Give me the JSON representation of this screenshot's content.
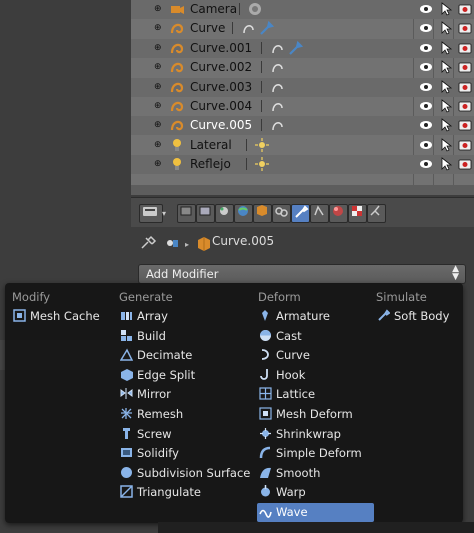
{
  "outliner": {
    "rows": [
      {
        "name": "Camera",
        "kind": "camera",
        "alt": true
      },
      {
        "name": "Curve",
        "kind": "curve",
        "alt": false,
        "wrench": true
      },
      {
        "name": "Curve.001",
        "kind": "curve",
        "alt": true,
        "wrench": true
      },
      {
        "name": "Curve.002",
        "kind": "curve",
        "alt": false
      },
      {
        "name": "Curve.003",
        "kind": "curve",
        "alt": true
      },
      {
        "name": "Curve.004",
        "kind": "curve",
        "alt": false
      },
      {
        "name": "Curve.005",
        "kind": "curve",
        "alt": true,
        "selected": true
      },
      {
        "name": "Lateral",
        "kind": "lamp",
        "alt": false
      },
      {
        "name": "Reflejo",
        "kind": "lamp",
        "alt": true
      }
    ]
  },
  "properties": {
    "active_object": "Curve.005",
    "add_modifier_label": "Add Modifier"
  },
  "menu": {
    "columns": [
      {
        "heading": "Modify",
        "items": [
          {
            "label": "Mesh Cache",
            "icon": "mesh-cache-icon"
          }
        ]
      },
      {
        "heading": "Generate",
        "items": [
          {
            "label": "Array",
            "icon": "array-icon"
          },
          {
            "label": "Build",
            "icon": "build-icon"
          },
          {
            "label": "Decimate",
            "icon": "decimate-icon"
          },
          {
            "label": "Edge Split",
            "icon": "edge-split-icon"
          },
          {
            "label": "Mirror",
            "icon": "mirror-icon"
          },
          {
            "label": "Remesh",
            "icon": "remesh-icon"
          },
          {
            "label": "Screw",
            "icon": "screw-icon"
          },
          {
            "label": "Solidify",
            "icon": "solidify-icon"
          },
          {
            "label": "Subdivision Surface",
            "icon": "subsurf-icon"
          },
          {
            "label": "Triangulate",
            "icon": "triangulate-icon"
          }
        ]
      },
      {
        "heading": "Deform",
        "items": [
          {
            "label": "Armature",
            "icon": "armature-icon"
          },
          {
            "label": "Cast",
            "icon": "cast-icon"
          },
          {
            "label": "Curve",
            "icon": "curve-icon"
          },
          {
            "label": "Hook",
            "icon": "hook-icon"
          },
          {
            "label": "Lattice",
            "icon": "lattice-icon"
          },
          {
            "label": "Mesh Deform",
            "icon": "mesh-deform-icon"
          },
          {
            "label": "Shrinkwrap",
            "icon": "shrinkwrap-icon"
          },
          {
            "label": "Simple Deform",
            "icon": "simple-deform-icon"
          },
          {
            "label": "Smooth",
            "icon": "smooth-icon"
          },
          {
            "label": "Warp",
            "icon": "warp-icon"
          },
          {
            "label": "Wave",
            "icon": "wave-icon",
            "highlighted": true
          }
        ]
      },
      {
        "heading": "Simulate",
        "items": [
          {
            "label": "Soft Body",
            "icon": "soft-body-icon"
          }
        ]
      }
    ]
  },
  "colors": {
    "accent": "#5680c2",
    "menu_bg": "#161616",
    "outliner_bg": "#727272"
  }
}
